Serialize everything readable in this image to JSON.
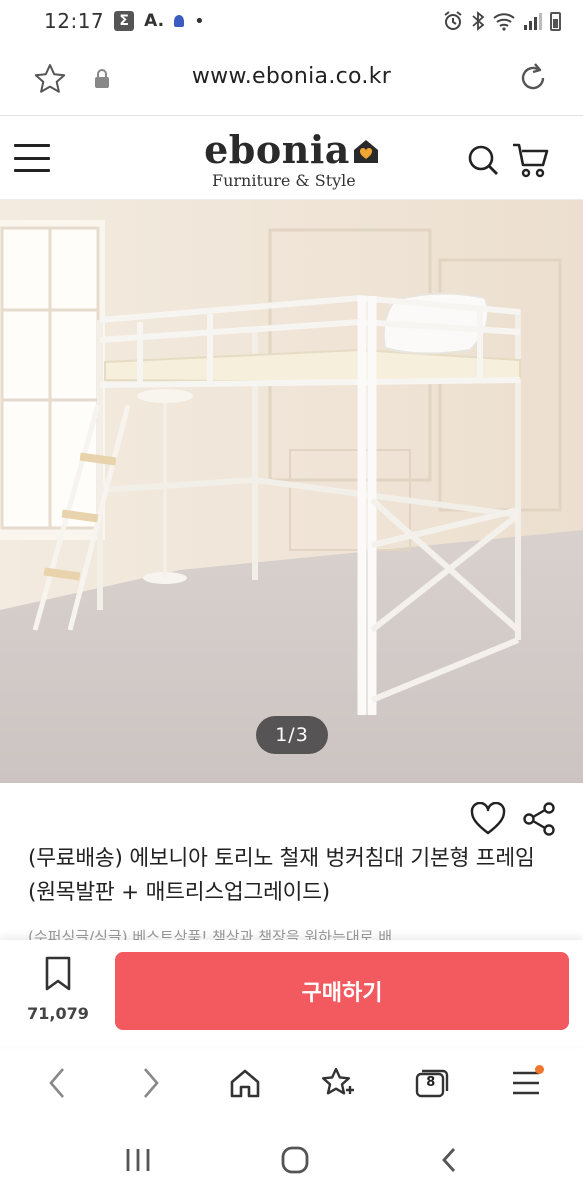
{
  "status_bar": {
    "time": "12:17",
    "sigma_icon": "Σ",
    "a_label": "A."
  },
  "browser": {
    "url": "www.ebonia.co.kr"
  },
  "site": {
    "logo_text": "ebonia",
    "logo_tagline": "Furniture & Style",
    "logo_accent": "#f1a533"
  },
  "hero": {
    "image_counter": "1/3"
  },
  "product": {
    "title": "(무료배송) 에보니아 토리노 철재 벙커침대 기본형 프레임 (원목발판 + 매트리스업그레이드)",
    "subtitle_partial": "(수퍼싱글/싱글) 베스트상품! 책상과 책장을 원하는대로 배"
  },
  "buy_bar": {
    "bookmark_count": "71,079",
    "buy_label": "구매하기",
    "buy_color": "#f35a60"
  },
  "browser_nav": {
    "tab_count": "8"
  }
}
